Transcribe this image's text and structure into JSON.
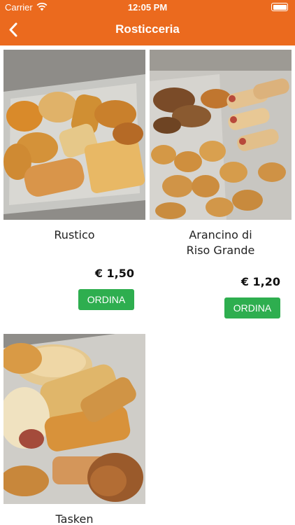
{
  "status_bar": {
    "carrier": "Carrier",
    "time": "12:05 PM"
  },
  "nav": {
    "title": "Rosticceria",
    "back_icon": "chevron-left-icon"
  },
  "colors": {
    "header": "#eb6a1e",
    "order_button": "#2eae4f"
  },
  "products": [
    {
      "name": "Rustico",
      "price": "€ 1,50",
      "button": "ORDINA"
    },
    {
      "name": "Arancino di Riso Grande",
      "price": "€ 1,20",
      "button": "ORDINA"
    },
    {
      "name": "Tasken"
    }
  ]
}
